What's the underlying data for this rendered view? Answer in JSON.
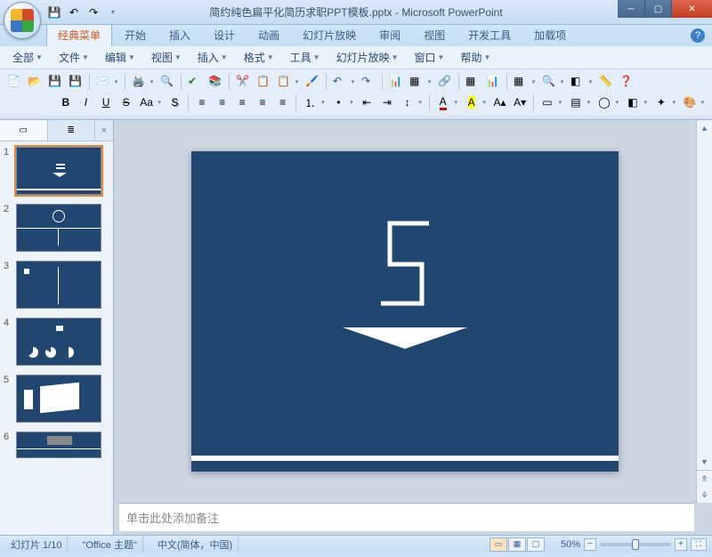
{
  "window": {
    "title": "简约纯色扁平化简历求职PPT模板.pptx - Microsoft PowerPoint"
  },
  "qat": {
    "save": "保存",
    "undo": "撤销",
    "redo": "重做"
  },
  "ribbon_tabs": [
    "经典菜单",
    "开始",
    "插入",
    "设计",
    "动画",
    "幻灯片放映",
    "审阅",
    "视图",
    "开发工具",
    "加载项"
  ],
  "active_ribbon_tab": 0,
  "classic_menu": [
    "全部",
    "文件",
    "编辑",
    "视图",
    "插入",
    "格式",
    "工具",
    "幻灯片放映",
    "窗口",
    "帮助"
  ],
  "toolbar_row1": {
    "new": "新建",
    "open": "打开",
    "save": "保存",
    "saveall": "全部保存",
    "mail": "邮件",
    "print": "打印",
    "preview": "打印预览",
    "spell": "拼写",
    "research": "信息检索",
    "cut": "剪切",
    "copy": "复制",
    "paste": "粘贴",
    "fmtpaint": "格式刷",
    "undo": "撤销",
    "redo": "重做",
    "chart": "图表",
    "table": "表格",
    "hyperlink": "超链接",
    "tableins": "插入表格",
    "chartins": "插入图表",
    "grid": "网格",
    "zoomctl": "显示比例",
    "colormode": "颜色/灰度",
    "ruler": "标尺",
    "help": "帮助"
  },
  "toolbar_row2": {
    "bold": "B",
    "italic": "I",
    "underline": "U",
    "strike": "S",
    "changecase": "Aa",
    "shadow": "阴影",
    "alignl": "左对齐",
    "alignc": "居中",
    "alignr": "右对齐",
    "justify": "两端对齐",
    "distribute": "分散对齐",
    "numlist": "编号",
    "bullist": "项目符号",
    "indentdec": "减少缩进",
    "indentinc": "增加缩进",
    "linespace": "行距",
    "fontcolor": "字体颜色",
    "highlight": "突出显示",
    "incsize": "增大字号",
    "decsize": "减小字号",
    "newslide": "新建幻灯片",
    "layout": "版式",
    "shapes": "形状",
    "arrange": "排列",
    "quickstyle": "快速样式",
    "design": "设计"
  },
  "outline_tabs": {
    "slides": "幻灯片",
    "outline": "大纲",
    "close": "×"
  },
  "thumbnails": [
    {
      "n": "1"
    },
    {
      "n": "2"
    },
    {
      "n": "3"
    },
    {
      "n": "4"
    },
    {
      "n": "5"
    },
    {
      "n": "6"
    }
  ],
  "selected_thumbnail": 0,
  "notes_placeholder": "单击此处添加备注",
  "statusbar": {
    "slide_pos": "幻灯片 1/10",
    "theme": "\"Office 主题\"",
    "lang": "中文(简体，中国)",
    "zoom_pct": "50%",
    "fit": "�募"
  }
}
